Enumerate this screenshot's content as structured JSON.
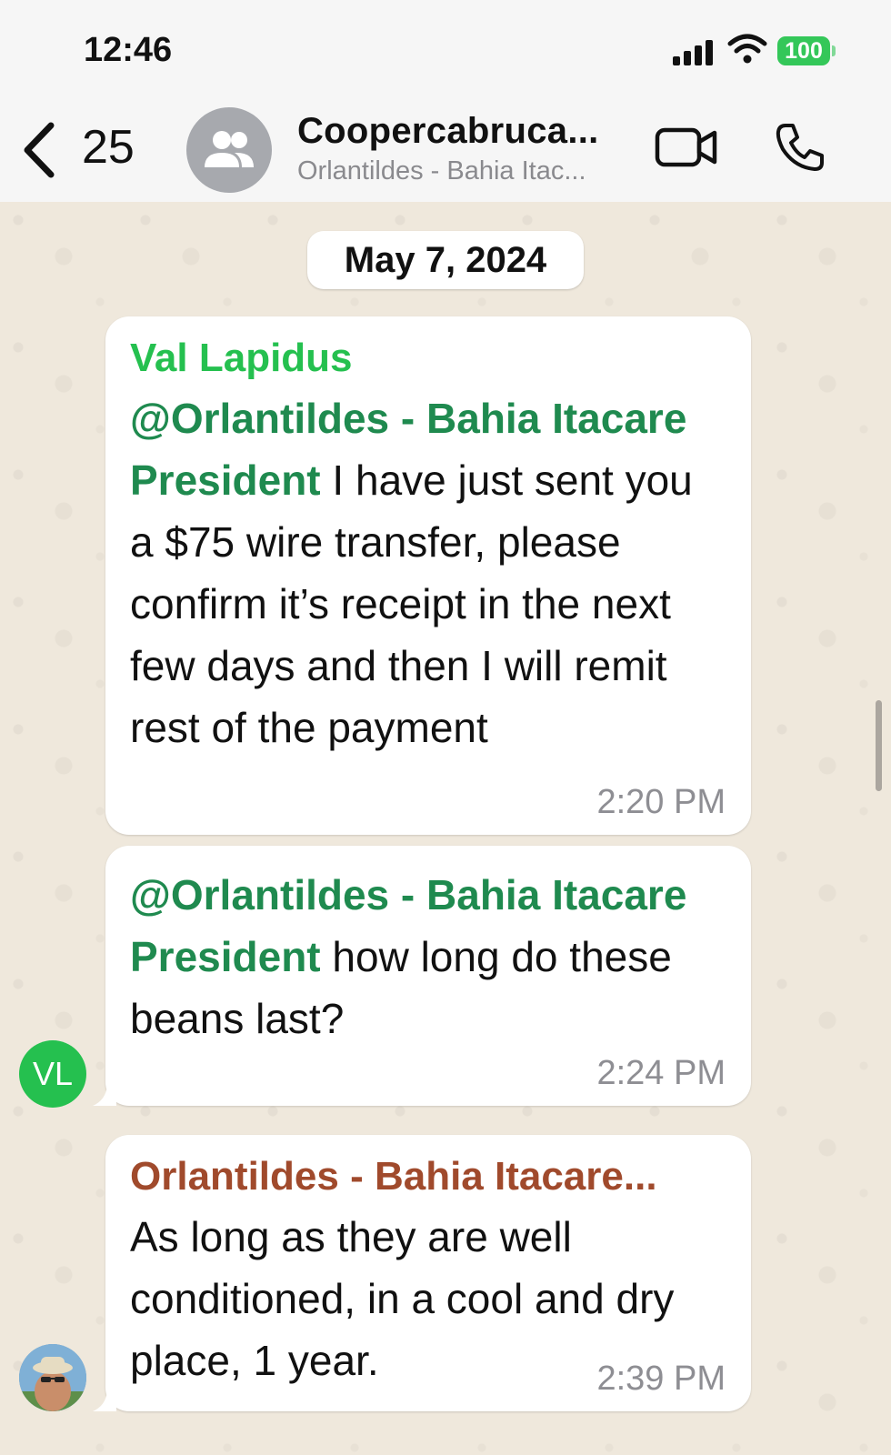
{
  "status_bar": {
    "time": "12:46",
    "battery": "100",
    "battery_color": "#34c759"
  },
  "header": {
    "back_count": "25",
    "title": "Coopercabruca...",
    "subtitle": "Orlantildes - Bahia Itac...",
    "icons": [
      "back-chevron-icon",
      "group-avatar-icon",
      "video-call-icon",
      "phone-call-icon"
    ]
  },
  "chat": {
    "date_label": "May 7, 2024",
    "messages": [
      {
        "sender": "Val Lapidus",
        "sender_color": "#25c04f",
        "mention": "@Orlantildes - Bahia Itacare President",
        "text": " I have just sent you a $75 wire transfer, please confirm it’s receipt in the next few days and then I will remit rest of the payment",
        "time": "2:20 PM"
      },
      {
        "sender": "",
        "mention": "@Orlantildes - Bahia Itacare President",
        "text": " how long do these beans last?",
        "time": "2:24 PM",
        "avatar_initials": "VL",
        "avatar_color": "#25c04f"
      },
      {
        "sender": "Orlantildes - Bahia Itacare...",
        "sender_color": "#a04a2c",
        "text": "As long as they are well conditioned, in a cool and dry place, 1 year.",
        "time": "2:39 PM",
        "avatar": "profile-photo"
      }
    ]
  }
}
